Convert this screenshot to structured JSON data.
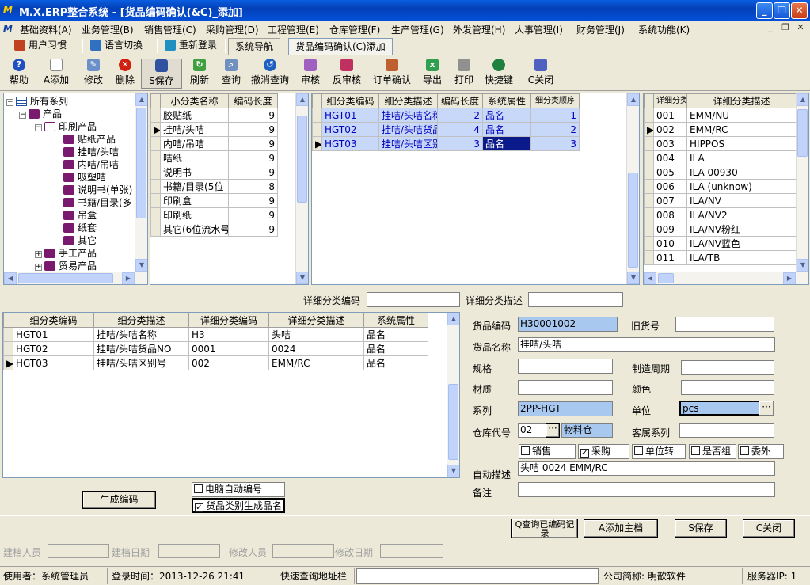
{
  "window": {
    "logo": "M",
    "title": "M.X.ERP整合系统 - [货品编码确认(&C)_添加]"
  },
  "window_buttons": {
    "min": "_",
    "max": "❐",
    "close": "✕"
  },
  "menu": [
    "基础资料(A)",
    "业务管理(B)",
    "销售管理(C)",
    "采购管理(D)",
    "工程管理(E)",
    "仓库管理(F)",
    "生产管理(G)",
    "外发管理(H)",
    "人事管理(I)",
    "财务管理(J)",
    "系统功能(K)"
  ],
  "mdi_buttons": {
    "min": "_",
    "restore": "❐",
    "close": "✕"
  },
  "tabs": {
    "habit": "用户习惯",
    "lang": "语言切换",
    "relogin": "重新登录",
    "nav": "系统导航",
    "doc": "货品编码确认(C)添加"
  },
  "toolbar": [
    "帮助",
    "A添加",
    "修改",
    "删除",
    "S保存",
    "刷新",
    "查询",
    "撤消查询",
    "审核",
    "反审核",
    "订单确认",
    "导出",
    "打印",
    "快捷键",
    "C关闭"
  ],
  "tree": {
    "root": "所有系列",
    "product": "产品",
    "printing": "印刷产品",
    "children": [
      "贴纸产品",
      "挂咭/头咭",
      "内咭/吊咭",
      "吸塑咭",
      "说明书(单张)",
      "书籍/目录(多",
      "吊盒",
      "纸套",
      "其它"
    ],
    "handwork": "手工产品",
    "trade": "贸易产品"
  },
  "small_class": {
    "headers": [
      "小分类名称",
      "编码长度"
    ],
    "rows": [
      [
        "胶贴纸",
        "9"
      ],
      [
        "挂咭/头咭",
        "9"
      ],
      [
        "内咭/吊咭",
        "9"
      ],
      [
        "咭纸",
        "9"
      ],
      [
        "说明书",
        "9"
      ],
      [
        "书籍/目录(5位",
        "8"
      ],
      [
        "印刷盒",
        "9"
      ],
      [
        " 印刷纸",
        "9"
      ],
      [
        "其它(6位流水号",
        "9"
      ]
    ],
    "current": 1
  },
  "detail_class": {
    "headers": [
      "细分类编码",
      "细分类描述",
      "编码长度",
      "系统属性",
      "细分类顺序"
    ],
    "rows": [
      [
        "HGT01",
        "挂咭/头咭名称",
        "2",
        "品名",
        "1"
      ],
      [
        "HGT02",
        "挂咭/头咭货品",
        "4",
        "品名",
        "2"
      ],
      [
        "HGT03",
        "挂咭/头咭区别",
        "3",
        "品名",
        "3"
      ]
    ]
  },
  "code_list": {
    "headers": [
      "详细分类编码",
      "详细分类描述"
    ],
    "rows": [
      [
        "001",
        "EMM/NU"
      ],
      [
        "002",
        "EMM/RC"
      ],
      [
        "003",
        "HIPPOS"
      ],
      [
        "004",
        "ILA"
      ],
      [
        "005",
        "ILA  00930"
      ],
      [
        "006",
        "ILA (unknow)"
      ],
      [
        "007",
        "ILA/NV"
      ],
      [
        "008",
        "ILA/NV2"
      ],
      [
        "009",
        "ILA/NV粉红"
      ],
      [
        "010",
        "ILA/NV蓝色"
      ],
      [
        "011",
        "ILA/TB"
      ]
    ],
    "current": 1
  },
  "filter": {
    "code_label": "详细分类编码",
    "desc_label": "详细分类描述",
    "code": "",
    "desc": ""
  },
  "bottom_grid": {
    "headers": [
      "细分类编码",
      "细分类描述",
      "详细分类编码",
      "详细分类描述",
      "系统属性"
    ],
    "rows": [
      [
        "HGT01",
        "挂咭/头咭名称",
        "H3",
        "头咭",
        "品名"
      ],
      [
        "HGT02",
        "挂咭/头咭货品NO",
        "0001",
        "0024",
        "品名"
      ],
      [
        "HGT03",
        "挂咭/头咭区别号",
        "002",
        "EMM/RC",
        "品名"
      ]
    ]
  },
  "form": {
    "code_label": "货品编码",
    "code": "H30001002",
    "old_label": "旧货号",
    "old": "",
    "name_label": "货品名称",
    "name": "挂咭/头咭",
    "spec_label": "规格",
    "spec": "",
    "cycle_label": "制造周期",
    "cycle": "",
    "material_label": "材质",
    "material": "",
    "color_label": "颜色",
    "color": "",
    "series_label": "系列",
    "series": "2PP-HGT",
    "unit_label": "单位",
    "unit": "pcs",
    "wh_label": "仓库代号",
    "wh_code": "02",
    "wh_name": "物料仓",
    "cust_label": "客属系列",
    "cust": "",
    "checks": [
      {
        "label": "销售",
        "checked": false
      },
      {
        "label": "采购",
        "checked": true
      },
      {
        "label": "单位转",
        "checked": false
      },
      {
        "label": "是否组",
        "checked": false
      },
      {
        "label": "委外",
        "checked": false
      }
    ],
    "auto_label": "自动描述",
    "auto": "头咭 0024 EMM/RC",
    "note_label": "备注",
    "note": ""
  },
  "options": {
    "generate": "生成编码",
    "auto_pc": "电脑自动编号",
    "auto_pc_checked": false,
    "gen_name": "货品类别生成品名",
    "gen_name_checked": true
  },
  "actions": {
    "query": "Q查询已编码记录",
    "add_main": "A添加主档",
    "save": "S保存",
    "close": "C关闭"
  },
  "audit": {
    "creator": "建档人员",
    "create_date": "建档日期",
    "modifier": "修改人员",
    "modify_date": "修改日期"
  },
  "status": {
    "user": "使用者：系统管理员",
    "login": "登录时间：2013-12-26 21:41",
    "quick": "快速查询地址栏",
    "company": "公司简称: 明歆软件",
    "server": "服务器IP:  1"
  }
}
